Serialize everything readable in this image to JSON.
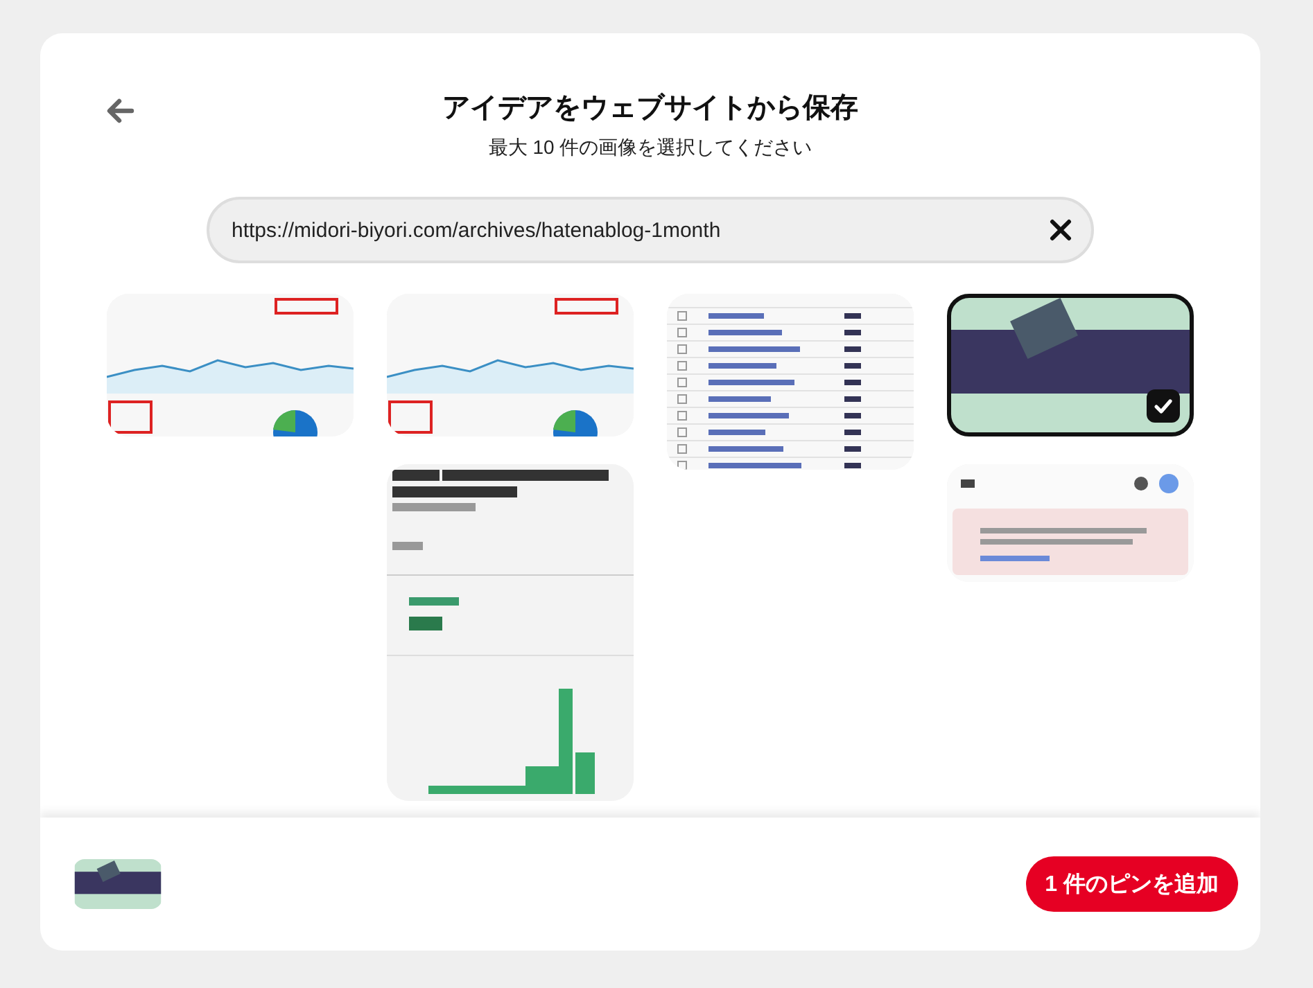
{
  "header": {
    "title": "アイデアをウェブサイトから保存",
    "subtitle": "最大 10 件の画像を選択してください"
  },
  "url_field": {
    "value": "https://midori-biyori.com/archives/hatenablog-1month"
  },
  "image_columns": [
    [
      {
        "kind": "analytics",
        "selected": false
      }
    ],
    [
      {
        "kind": "analytics",
        "selected": false
      },
      {
        "kind": "report",
        "selected": false
      }
    ],
    [
      {
        "kind": "table",
        "selected": false
      }
    ],
    [
      {
        "kind": "banner",
        "selected": true
      },
      {
        "kind": "alert",
        "selected": false
      }
    ]
  ],
  "footer": {
    "add_button": "1 件のピンを追加"
  }
}
